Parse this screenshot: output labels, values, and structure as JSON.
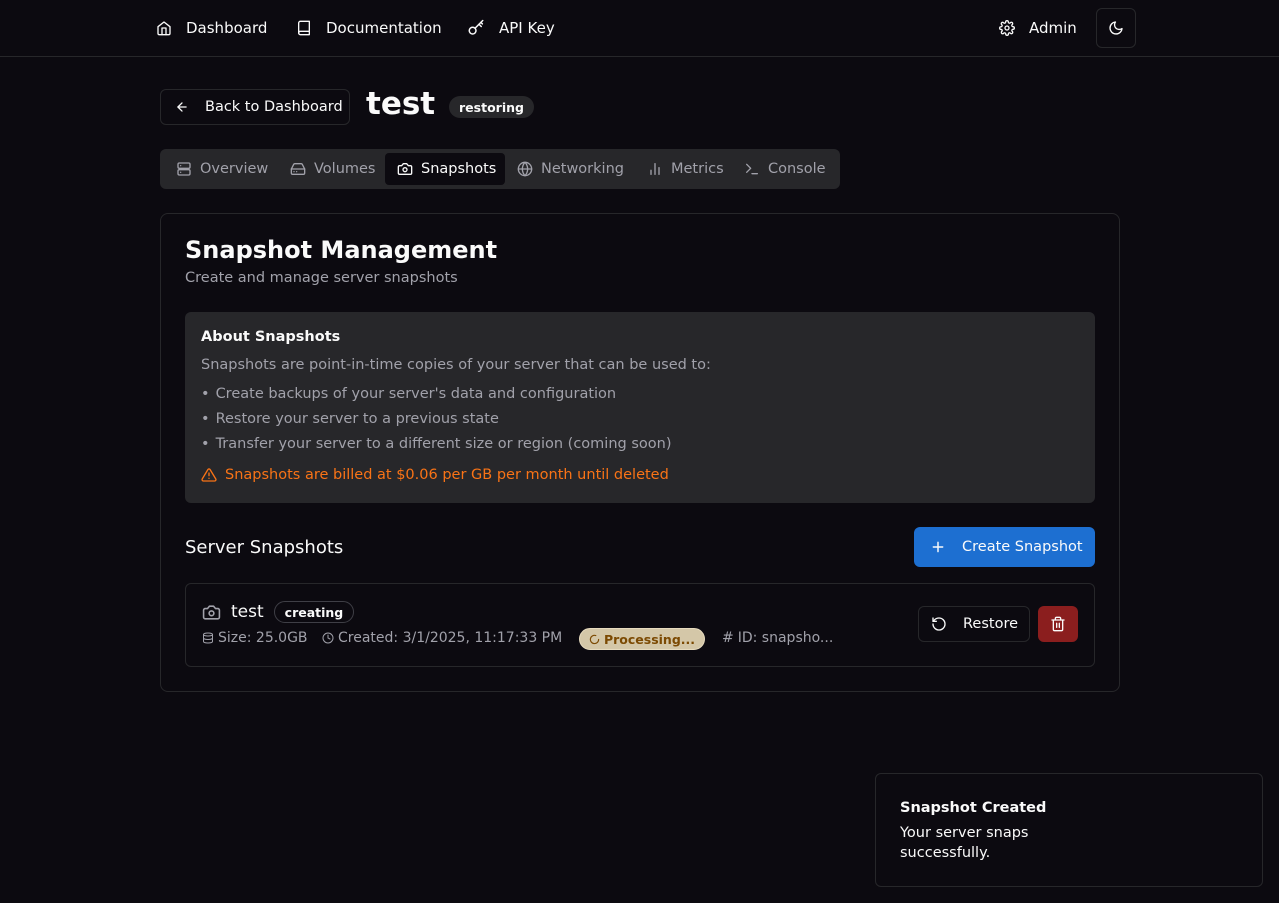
{
  "nav": {
    "dashboard_label": "Dashboard",
    "documentation_label": "Documentation",
    "api_key_label": "API Key",
    "admin_label": "Admin"
  },
  "header": {
    "back_label": "Back to Dashboard",
    "server_name": "test",
    "server_status": "restoring"
  },
  "tabs": [
    {
      "label": "Overview",
      "icon": "server-icon"
    },
    {
      "label": "Volumes",
      "icon": "hard-drive-icon"
    },
    {
      "label": "Snapshots",
      "icon": "camera-icon",
      "active": true
    },
    {
      "label": "Networking",
      "icon": "globe-icon"
    },
    {
      "label": "Metrics",
      "icon": "bar-chart-icon"
    },
    {
      "label": "Console",
      "icon": "terminal-icon"
    }
  ],
  "card": {
    "title": "Snapshot Management",
    "subtitle": "Create and manage server snapshots",
    "about": {
      "title": "About Snapshots",
      "intro": "Snapshots are point-in-time copies of your server that can be used to:",
      "items": [
        "Create backups of your server's data and configuration",
        "Restore your server to a previous state",
        "Transfer your server to a different size or region (coming soon)"
      ],
      "warning": "Snapshots are billed at $0.06 per GB per month until deleted"
    },
    "section_title": "Server Snapshots",
    "create_label": "Create Snapshot",
    "snapshot": {
      "name": "test",
      "badge": "creating",
      "size": "Size: 25.0GB",
      "created": "Created: 3/1/2025, 11:17:33 PM",
      "processing": "Processing...",
      "id": "ID: snapsho...",
      "restore_label": "Restore"
    }
  },
  "toast": {
    "title": "Snapshot Created",
    "description": "Your server snaps successfully."
  },
  "colors": {
    "background": "#0c0a10",
    "primary": "#1d6fd1",
    "danger": "#8b1e1e",
    "warning": "#f97316"
  }
}
